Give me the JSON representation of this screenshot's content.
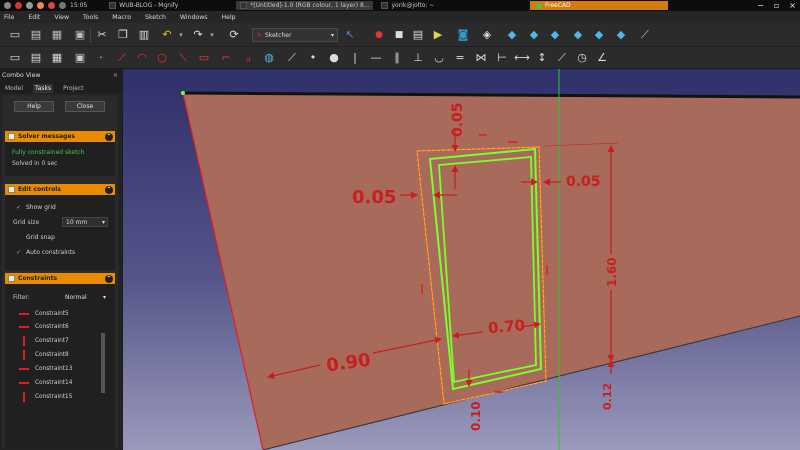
{
  "taskbar": {
    "time": "15:05",
    "window1": "WUB-BLOG - Mgnify",
    "window2": "*[Untitled]-1.0 (RGB colour, 1 layer) 8...",
    "window3": "yorik@jolto: ~",
    "freecad": "FreeCAD"
  },
  "menu": [
    "File",
    "Edit",
    "View",
    "Tools",
    "Macro",
    "Sketch",
    "Windows",
    "Help"
  ],
  "toolbar": {
    "workbench": "Sketcher"
  },
  "combo": {
    "title": "Combo View",
    "tabs": [
      "Model",
      "Tasks",
      "Project"
    ],
    "help_label": "Help",
    "close_label": "Close",
    "solver": {
      "title": "Solver messages",
      "line1": "Fully constrained sketch",
      "line2": "Solved in 0 sec"
    },
    "edit": {
      "title": "Edit controls",
      "show_grid": "Show grid",
      "grid_size_label": "Grid size",
      "grid_size_value": "10 mm",
      "grid_snap": "Grid snap",
      "auto_constraints": "Auto constraints"
    },
    "constraints": {
      "title": "Constraints",
      "filter_label": "Filter:",
      "filter_value": "Normal",
      "items": [
        {
          "name": "Constraint5",
          "kind": "horizontal"
        },
        {
          "name": "Constraint6",
          "kind": "horizontal"
        },
        {
          "name": "Constraint7",
          "kind": "vertical"
        },
        {
          "name": "Constraint8",
          "kind": "vertical"
        },
        {
          "name": "Constraint13",
          "kind": "horizontal"
        },
        {
          "name": "Constraint14",
          "kind": "horizontal"
        },
        {
          "name": "Constraint15",
          "kind": "vertical"
        }
      ]
    }
  },
  "dimensions": {
    "d1": "0.05",
    "d2": "0.05",
    "d3": "0.05",
    "d4": "0.70",
    "d5": "0.90",
    "d6": "1.60",
    "d7": "0.10",
    "d8": "0.12"
  },
  "colors": {
    "accent": "#e88b00",
    "dimension": "#c81e1e",
    "geometry": "#7cff2a",
    "plane": "#a86a5a"
  }
}
